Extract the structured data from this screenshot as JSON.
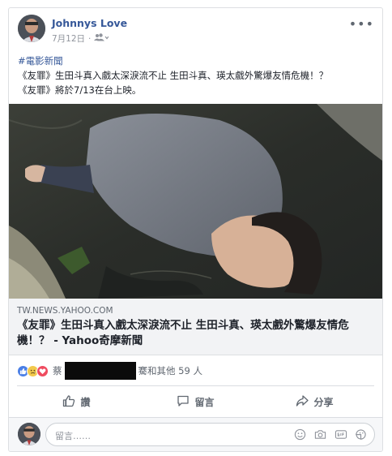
{
  "post": {
    "author": "Johnnys Love",
    "date": "7月12日",
    "more_label": "•••",
    "hashtag": "#電影新聞",
    "text_line1": "《友罪》生田斗真入戲太深淚流不止 生田斗真、瑛太戲外驚爆友情危機！？",
    "text_line2": "《友罪》將於7/13在台上映。"
  },
  "link": {
    "domain": "TW.NEWS.YAHOO.COM",
    "title": "《友罪》生田斗真入戲太深淚流不止 生田斗真、瑛太戲外驚爆友情危機！？ - Yahoo奇摩新聞"
  },
  "reactions": {
    "name_start": "蔡",
    "name_mid": "騫",
    "summary": "和其他 59 人"
  },
  "actions": {
    "like": "讚",
    "comment": "留言",
    "share": "分享"
  },
  "comment_box": {
    "placeholder": "留言……"
  },
  "colors": {
    "link_blue": "#365899",
    "like_blue": "#4a7fe6",
    "love_red": "#ef4b5f",
    "sad_yellow": "#f2c94c"
  }
}
